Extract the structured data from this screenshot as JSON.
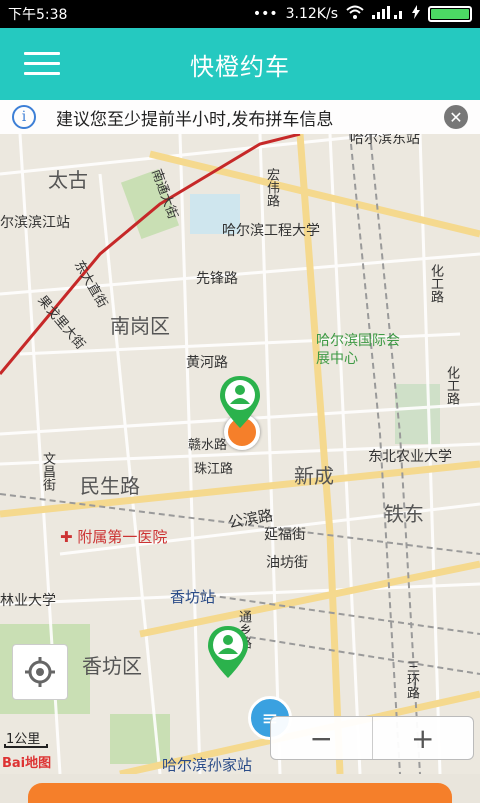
{
  "status_bar": {
    "time": "下午5:38",
    "dots": "•••",
    "network_speed": "3.12K/s",
    "battery_percent": 100
  },
  "app_bar": {
    "title": "快橙约车"
  },
  "notice": {
    "text": "建议您至少提前半小时,发布拼车信息"
  },
  "map": {
    "labels": {
      "taigu": "太古",
      "harbin_binjiang": "尔滨滨江站",
      "harbin_east": "哈尔滨东站",
      "hongwei": "宏伟路",
      "engineering_univ": "哈尔滨工程大学",
      "xianfeng": "先锋路",
      "nangang": "南岗区",
      "huayuan": "果戈里大街",
      "dongda": "东大直街",
      "nantong": "南通大街",
      "huanghe": "黄河路",
      "expo_center": "哈尔滨国际会展中心",
      "huagong1": "化工路",
      "huagong2": "化工路",
      "ganshui": "赣水路",
      "zhujiang": "珠江路",
      "northeast_ag": "东北农业大学",
      "xincheng": "新成",
      "minsheng": "民生路",
      "wenchang": "文昌街",
      "tiedong": "铁东",
      "gongbin": "公滨路",
      "yanfu": "延福街",
      "youfang": "油坊街",
      "hospital": "附属第一医院",
      "forestry": "林业大学",
      "xiangfang_station": "香坊站",
      "xiangfang_district": "香坊区",
      "tonglu": "通乡路",
      "sanhuan": "三环路",
      "sunjia_station": "哈尔滨孙家站"
    },
    "scale_label": "1公里",
    "logo_text": "Bai地图"
  },
  "zoom": {
    "zoom_out": "−",
    "zoom_in": "+"
  },
  "colors": {
    "accent": "#25c9c0",
    "orange": "#f57f2a",
    "pin_green": "#2bb24c",
    "railway_red": "#c62828"
  }
}
